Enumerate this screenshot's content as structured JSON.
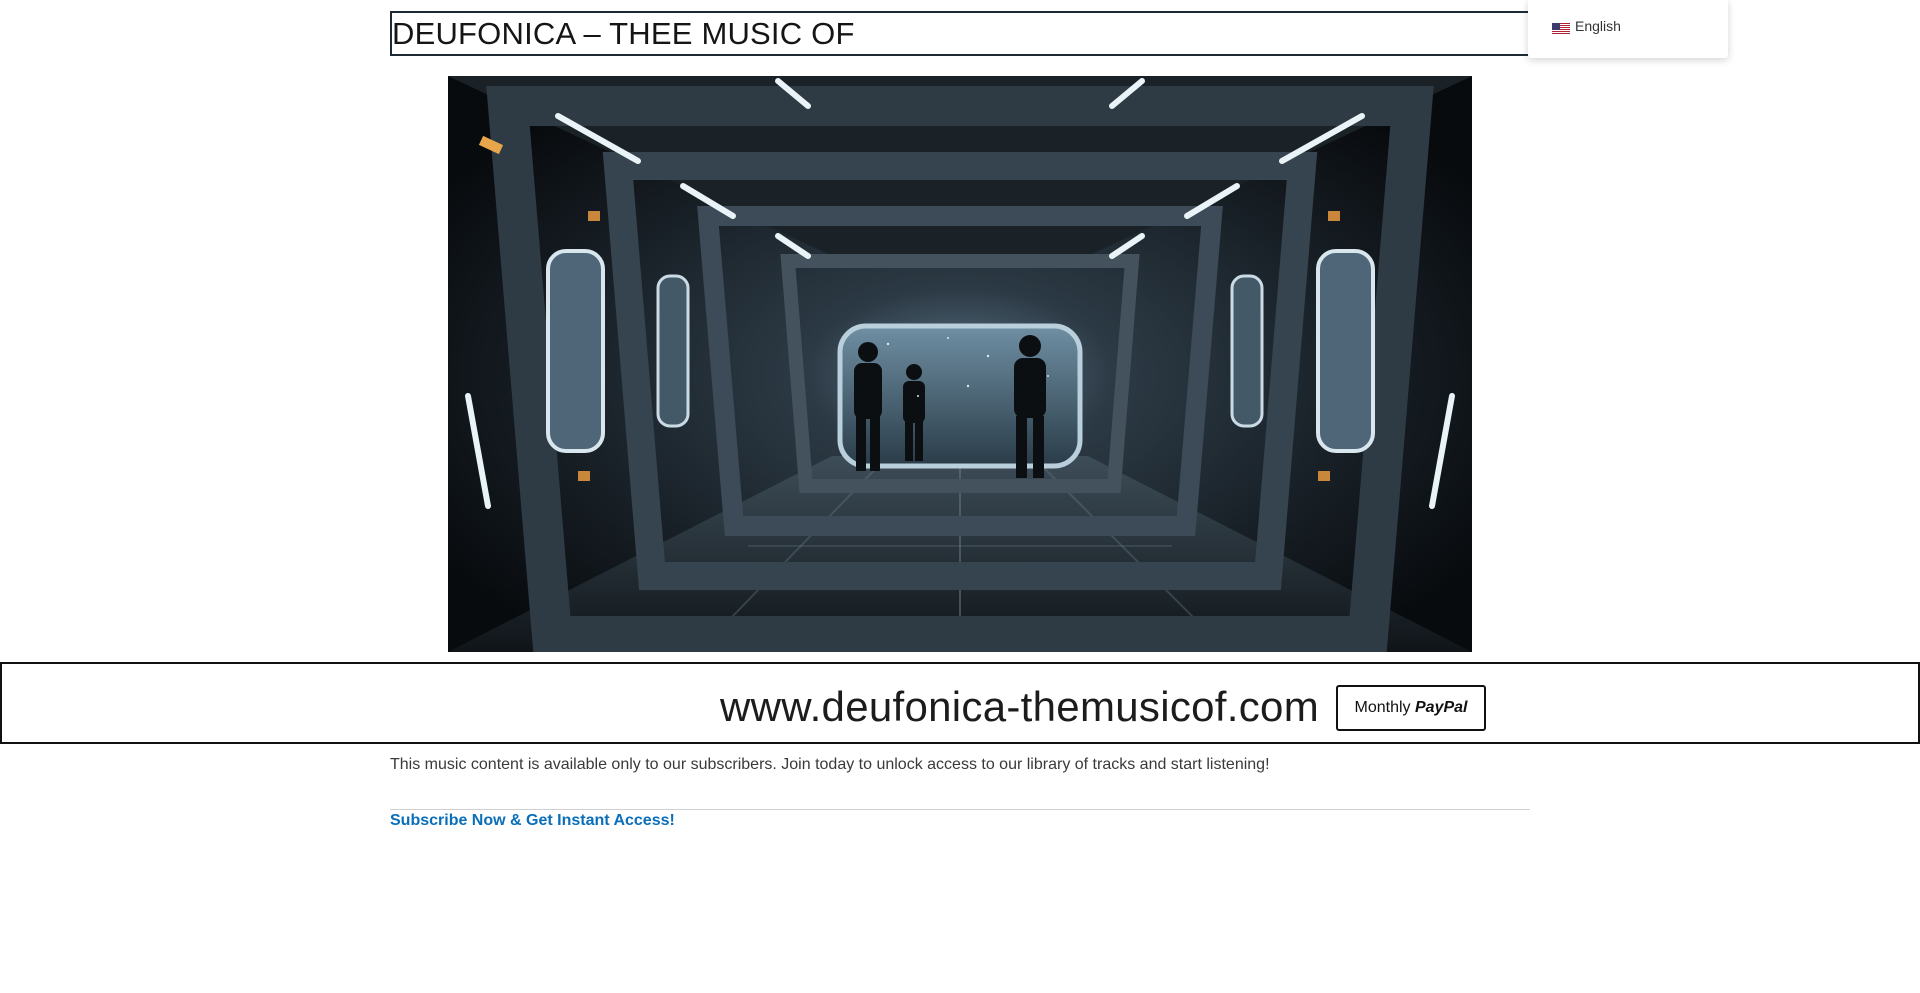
{
  "header": {
    "title": "DEUFONICA – THEE MUSIC OF"
  },
  "language_switcher": {
    "selected": "English",
    "flag_icon": "us-flag-icon"
  },
  "hero_image": {
    "description_icon": "spaceship-corridor-image"
  },
  "banner": {
    "url_text": "www.deufonica-themusicof.com",
    "paypal_button": {
      "prefix": "Monthly",
      "brand": "PayPal"
    }
  },
  "content": {
    "notice": "This music content is available only to our subscribers. Join today to unlock access to our library of tracks and start listening!",
    "subscribe_link": "Subscribe Now & Get Instant Access!"
  },
  "colors": {
    "link": "#0a6fba",
    "border": "#111111",
    "text": "#3a3a3a"
  }
}
